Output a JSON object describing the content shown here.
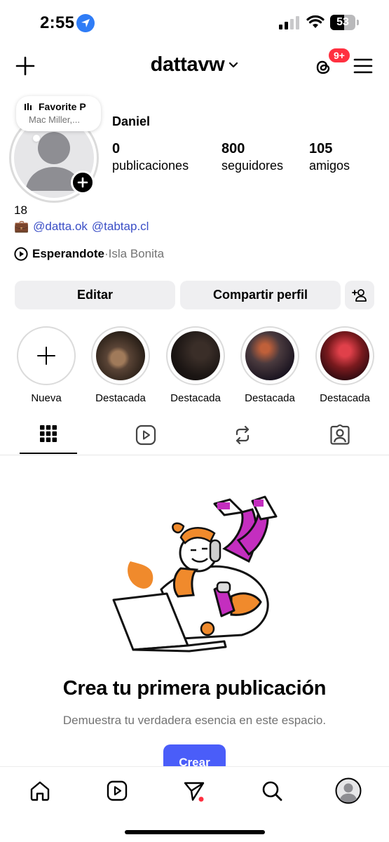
{
  "status_bar": {
    "time": "2:55",
    "battery": "53"
  },
  "header": {
    "username": "dattavw",
    "threads_badge": "9+"
  },
  "note": {
    "title": "Favorite P",
    "subtitle": "Mac Miller,..."
  },
  "profile": {
    "name": "Daniel",
    "stats": [
      {
        "value": "0",
        "label": "publicaciones"
      },
      {
        "value": "800",
        "label": "seguidores"
      },
      {
        "value": "105",
        "label": "amigos"
      }
    ],
    "bio_line1": "18",
    "bio_emoji": "💼",
    "bio_links": [
      "@datta.ok",
      "@tabtap.cl"
    ],
    "music": {
      "song": "Esperandote",
      "separator": " · ",
      "artist": "Isla Bonita"
    }
  },
  "buttons": {
    "edit": "Editar",
    "share": "Compartir perfil"
  },
  "highlights": [
    {
      "label": "Nueva",
      "kind": "new"
    },
    {
      "label": "Destacada",
      "color": "#5a4436"
    },
    {
      "label": "Destacada",
      "color": "#1c1614"
    },
    {
      "label": "Destacada",
      "color": "#4a3a3e"
    },
    {
      "label": "Destacada",
      "color": "#7a1a1e"
    }
  ],
  "empty_state": {
    "title": "Crea tu primera publicación",
    "subtitle": "Demuestra tu verdadera esencia en este espacio.",
    "cta": "Crear"
  },
  "colors": {
    "accent": "#4a5df9",
    "link": "#3a4ec6",
    "badge": "#ff3040",
    "illustration_orange": "#f08a2c",
    "illustration_magenta": "#c42ebf"
  }
}
